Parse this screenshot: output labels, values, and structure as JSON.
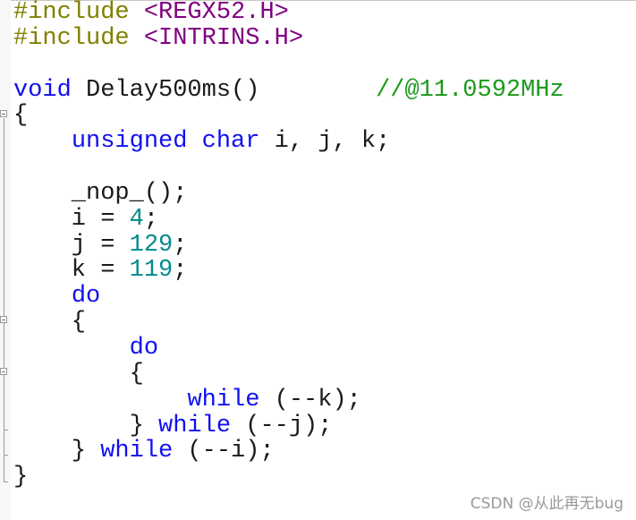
{
  "editor": {
    "lines": [
      [
        {
          "t": "#include ",
          "c": "pp"
        },
        {
          "t": "<REGX52.H>",
          "c": "inc"
        }
      ],
      [
        {
          "t": "#include ",
          "c": "pp"
        },
        {
          "t": "<INTRINS.H>",
          "c": "inc"
        }
      ],
      [],
      [
        {
          "t": "void",
          "c": "kw"
        },
        {
          "t": " Delay500ms()        ",
          "c": "pl"
        },
        {
          "t": "//@11.0592MHz",
          "c": "cm"
        }
      ],
      [
        {
          "t": "{",
          "c": "pl"
        }
      ],
      [
        {
          "t": "    ",
          "c": "pl"
        },
        {
          "t": "unsigned",
          "c": "kw"
        },
        {
          "t": " ",
          "c": "pl"
        },
        {
          "t": "char",
          "c": "kw"
        },
        {
          "t": " i, j, k;",
          "c": "pl"
        }
      ],
      [],
      [
        {
          "t": "    _nop_();",
          "c": "pl"
        }
      ],
      [
        {
          "t": "    i = ",
          "c": "pl"
        },
        {
          "t": "4",
          "c": "num"
        },
        {
          "t": ";",
          "c": "pl"
        }
      ],
      [
        {
          "t": "    j = ",
          "c": "pl"
        },
        {
          "t": "129",
          "c": "num"
        },
        {
          "t": ";",
          "c": "pl"
        }
      ],
      [
        {
          "t": "    k = ",
          "c": "pl"
        },
        {
          "t": "119",
          "c": "num"
        },
        {
          "t": ";",
          "c": "pl"
        }
      ],
      [
        {
          "t": "    ",
          "c": "pl"
        },
        {
          "t": "do",
          "c": "kw"
        }
      ],
      [
        {
          "t": "    {",
          "c": "pl"
        }
      ],
      [
        {
          "t": "        ",
          "c": "pl"
        },
        {
          "t": "do",
          "c": "kw"
        }
      ],
      [
        {
          "t": "        {",
          "c": "pl"
        }
      ],
      [
        {
          "t": "            ",
          "c": "pl"
        },
        {
          "t": "while",
          "c": "kw"
        },
        {
          "t": " (--k);",
          "c": "pl"
        }
      ],
      [
        {
          "t": "        } ",
          "c": "pl"
        },
        {
          "t": "while",
          "c": "kw"
        },
        {
          "t": " (--j);",
          "c": "pl"
        }
      ],
      [
        {
          "t": "    } ",
          "c": "pl"
        },
        {
          "t": "while",
          "c": "kw"
        },
        {
          "t": " (--i);",
          "c": "pl"
        }
      ],
      [
        {
          "t": "}",
          "c": "pl"
        }
      ]
    ]
  },
  "watermark": "CSDN @从此再无bug",
  "colors": {
    "keyword": "#1010f0",
    "preprocessor": "#808000",
    "include_path": "#800080",
    "number": "#008b8b",
    "comment": "#1a9a1a"
  }
}
